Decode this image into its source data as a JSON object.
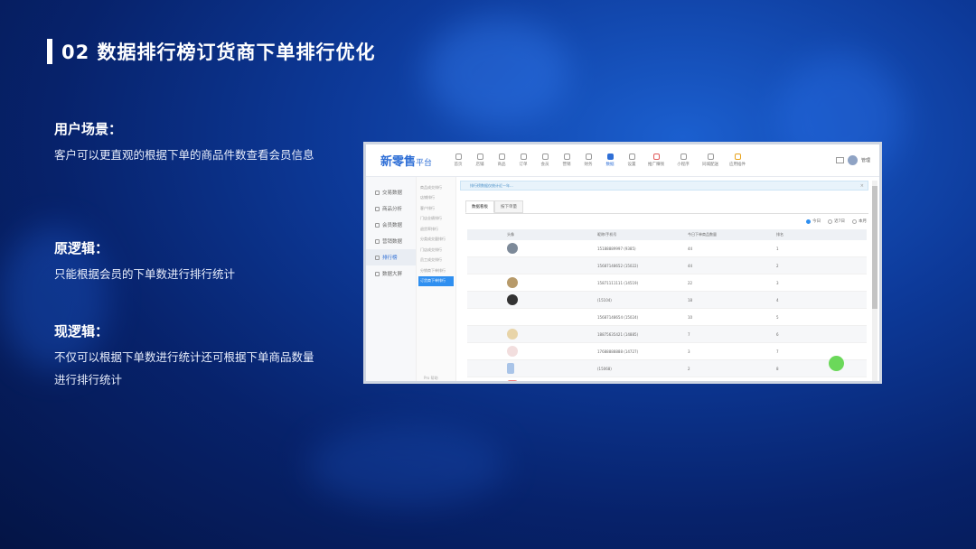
{
  "slide": {
    "title": "02 数据排行榜订货商下单排行优化",
    "sections": [
      {
        "heading": "用户场景：",
        "body": "客户可以更直观的根据下单的商品件数查看会员信息"
      },
      {
        "heading": "原逻辑：",
        "body": "只能根据会员的下单数进行排行统计"
      },
      {
        "heading": "现逻辑：",
        "body": "不仅可以根据下单数进行统计还可根据下单商品数量进行排行统计"
      }
    ]
  },
  "app": {
    "logo_main": "新零售",
    "logo_sub": "平台",
    "nav": [
      {
        "label": "首页",
        "icon": "home-icon"
      },
      {
        "label": "店铺",
        "icon": "shop-icon"
      },
      {
        "label": "商品",
        "icon": "goods-icon"
      },
      {
        "label": "订单",
        "icon": "order-icon"
      },
      {
        "label": "会员",
        "icon": "member-icon"
      },
      {
        "label": "营销",
        "icon": "marketing-icon"
      },
      {
        "label": "财务",
        "icon": "finance-icon"
      },
      {
        "label": "数据",
        "icon": "data-icon",
        "active": true
      },
      {
        "label": "设置",
        "icon": "settings-icon"
      },
      {
        "label": "推广赚钱",
        "icon": "promote-icon"
      },
      {
        "label": "小程序",
        "icon": "miniapp-icon"
      },
      {
        "label": "同城配送",
        "icon": "delivery-icon"
      },
      {
        "label": "应用插件",
        "icon": "plugin-icon"
      }
    ],
    "user_label": "管理",
    "sidebar_primary": [
      {
        "label": "交易数据"
      },
      {
        "label": "商品分析"
      },
      {
        "label": "会员数据"
      },
      {
        "label": "营销数据"
      },
      {
        "label": "排行榜",
        "active": true
      },
      {
        "label": "数据大屏"
      }
    ],
    "sidebar_secondary": [
      {
        "label": "商品成交排行"
      },
      {
        "label": "店铺排行"
      },
      {
        "label": "客户排行"
      },
      {
        "label": "门店业绩排行"
      },
      {
        "label": "退货率排行"
      },
      {
        "label": "分类成交量排行"
      },
      {
        "label": "门店成交排行"
      },
      {
        "label": "员工成交排行"
      },
      {
        "label": "分销商下单排行"
      },
      {
        "label": "订货商下单排行",
        "active": true
      }
    ],
    "sidebar_footer": "Pro  帮助",
    "notice": "排行榜数据仅统计近一年...",
    "tabs": [
      {
        "label": "数据看板",
        "active": true
      },
      {
        "label": "按下单量",
        "active": false
      }
    ],
    "radios": [
      {
        "label": "今日",
        "checked": true
      },
      {
        "label": "近7日",
        "checked": false
      },
      {
        "label": "本月",
        "checked": false
      }
    ],
    "table": {
      "headers": [
        "头像",
        "昵称/手机号",
        "今日下单商品数量",
        "排名"
      ],
      "rows": [
        {
          "avatar": true,
          "id": "15188889997 (9385)",
          "count": "44",
          "rank": "1"
        },
        {
          "avatar": false,
          "id": "15687148652 (15022)",
          "count": "44",
          "rank": "2"
        },
        {
          "avatar": true,
          "id": "15871111111 (14519)",
          "count": "22",
          "rank": "3"
        },
        {
          "avatar": true,
          "id": "(15104)",
          "count": "18",
          "rank": "4"
        },
        {
          "avatar": false,
          "id": "15687148654 (15024)",
          "count": "10",
          "rank": "5"
        },
        {
          "avatar": true,
          "id": "18875635421 (14885)",
          "count": "7",
          "rank": "6"
        },
        {
          "avatar": true,
          "id": "17688888888 (14727)",
          "count": "3",
          "rank": "7"
        },
        {
          "avatar": true,
          "id": "(15068)",
          "count": "2",
          "rank": "8"
        },
        {
          "avatar": true,
          "id": "18811114724 (14600)",
          "count": "1",
          "rank": "9"
        }
      ]
    }
  }
}
